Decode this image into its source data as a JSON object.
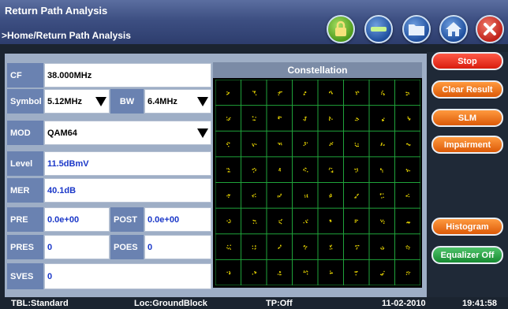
{
  "header": {
    "title": "Return Path Analysis",
    "breadcrumb": ">Home/Return Path Analysis"
  },
  "top_icons": [
    "lock-icon",
    "minus-icon",
    "folder-icon",
    "home-icon",
    "close-icon"
  ],
  "fields": {
    "cf": {
      "label": "CF",
      "value": "38.000MHz"
    },
    "symbol": {
      "label": "Symbol",
      "value": "5.12MHz"
    },
    "bw": {
      "label": "BW",
      "value": "6.4MHz"
    },
    "mod": {
      "label": "MOD",
      "value": "QAM64"
    },
    "level": {
      "label": "Level",
      "value": "11.5dBmV"
    },
    "mer": {
      "label": "MER",
      "value": "40.1dB"
    },
    "pre": {
      "label": "PRE",
      "value": "0.0e+00"
    },
    "post": {
      "label": "POST",
      "value": "0.0e+00"
    },
    "pres": {
      "label": "PRES",
      "value": "0"
    },
    "poes": {
      "label": "POES",
      "value": "0"
    },
    "sves": {
      "label": "SVES",
      "value": "0"
    }
  },
  "constellation": {
    "title": "Constellation",
    "grid_size": 8,
    "grid_color": "#1fa33a",
    "point_color": "#e6d300"
  },
  "buttons": {
    "stop": "Stop",
    "clear_result": "Clear Result",
    "slm": "SLM",
    "impairment": "Impairment",
    "histogram": "Histogram",
    "equalizer_off": "Equalizer Off"
  },
  "status": {
    "tbl": "TBL:Standard",
    "loc": "Loc:GroundBlock",
    "tp": "TP:Off",
    "date": "11-02-2010",
    "time": "19:41:58"
  }
}
